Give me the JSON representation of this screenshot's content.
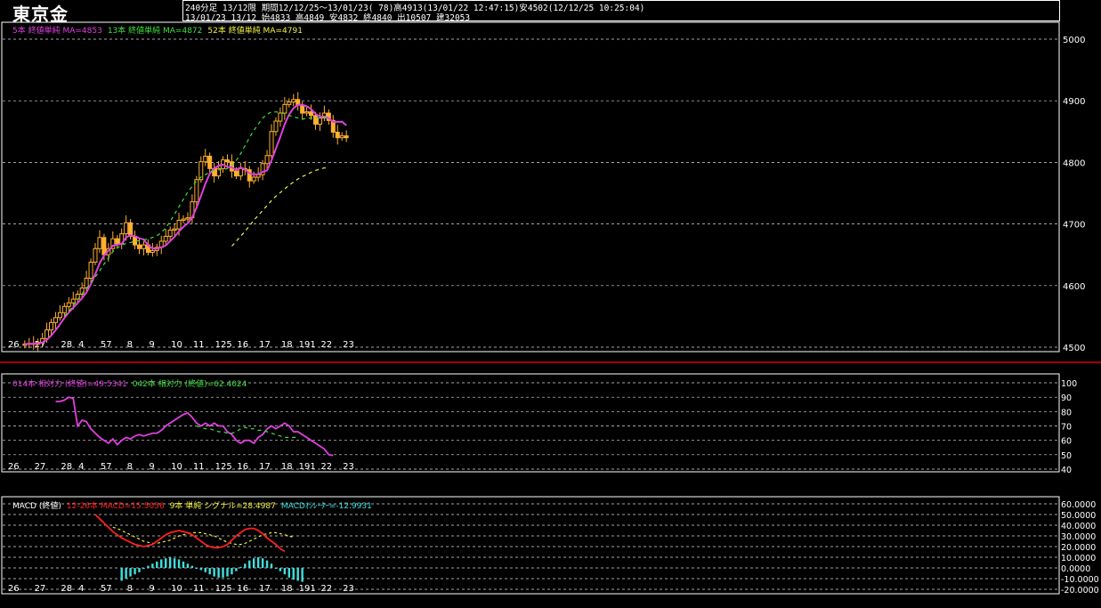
{
  "header": {
    "title": "東京金",
    "line1": "240分足 13/12限 期間12/12/25〜13/01/23( 78)高4913(13/01/22 12:47:15)安4502(12/12/25 10:25:04)",
    "line2": "13/01/23 13/12 始4833 高4849 安4832 終4840 出10507 建32053"
  },
  "colors": {
    "background": "#000000",
    "candle": "#ffb030",
    "ma5": "#e040e0",
    "ma13": "#40e040",
    "ma52": "#f0f040",
    "rsi14": "#e040e0",
    "rsi42": "#40e040",
    "macd": "#ff2020",
    "signal": "#f0f040",
    "oscillator": "#40e0e0",
    "separator": "#ff0000"
  },
  "legends": {
    "main": [
      {
        "text": "5本 終値単純 MA=4853",
        "color": "#e040e0"
      },
      {
        "text": "13本 終値単純 MA=4872",
        "color": "#40e040"
      },
      {
        "text": "52本 終値単純 MA=4791",
        "color": "#f0f040"
      }
    ],
    "rsi": [
      {
        "text": "014本 相対力 (終値)=49.5341",
        "color": "#e040e0"
      },
      {
        "text": "042本 相対力 (終値)=62.4024",
        "color": "#40e040"
      }
    ],
    "macd": [
      {
        "text": "MACD (終値)",
        "color": "#ffffff"
      },
      {
        "text": "12-26本 MACD=15.5056",
        "color": "#ff2020"
      },
      {
        "text": "9本 単純 シグナル=28.4987",
        "color": "#f0f040"
      },
      {
        "text": "MACDｵｼﾚｰﾀｰ=-12.9931",
        "color": "#40e0e0"
      }
    ]
  },
  "chart_data": [
    {
      "type": "candlestick",
      "name": "price",
      "ylim": [
        4500,
        5050
      ],
      "yticks": [
        "5000",
        "4900",
        "4800",
        "4700",
        "4600",
        "4500"
      ],
      "ytick_values": [
        5000,
        4900,
        4800,
        4700,
        4600,
        4500
      ],
      "date_labels": [
        "26",
        "27",
        "28",
        "4",
        "57",
        "8",
        "9",
        "10",
        "11",
        "125",
        "16",
        "17",
        "18",
        "191",
        "22",
        "23"
      ],
      "date_label_index": [
        1,
        7,
        13,
        17,
        22,
        28,
        33,
        38,
        43,
        48,
        53,
        58,
        63,
        67,
        72,
        77
      ],
      "close": [
        4505,
        4506,
        4505,
        4508,
        4514,
        4528,
        4540,
        4548,
        4556,
        4566,
        4572,
        4578,
        4586,
        4596,
        4612,
        4638,
        4660,
        4678,
        4650,
        4660,
        4676,
        4668,
        4684,
        4702,
        4680,
        4666,
        4660,
        4666,
        4654,
        4657,
        4662,
        4672,
        4680,
        4690,
        4692,
        4706,
        4708,
        4710,
        4736,
        4772,
        4801,
        4810,
        4790,
        4778,
        4790,
        4804,
        4801,
        4786,
        4778,
        4790,
        4788,
        4770,
        4776,
        4780,
        4798,
        4811,
        4850,
        4867,
        4880,
        4894,
        4898,
        4902,
        4893,
        4880,
        4882,
        4876,
        4862,
        4872,
        4880,
        4868,
        4849,
        4840,
        4843,
        4840
      ],
      "ma5": [
        4505,
        4505.5,
        4505.3,
        4506,
        4507.6,
        4512,
        4519,
        4527.6,
        4537.2,
        4547.6,
        4556.4,
        4564,
        4571.6,
        4579.6,
        4588.8,
        4602,
        4618.4,
        4636.4,
        4648.8,
        4656.8,
        4664.8,
        4666.4,
        4667.6,
        4678,
        4682,
        4680,
        4676.8,
        4674.8,
        4665.2,
        4660.6,
        4659.8,
        4662.2,
        4665,
        4672.2,
        4679.2,
        4688,
        4695.2,
        4701.2,
        4710.4,
        4726.4,
        4745.4,
        4765.4,
        4781.8,
        4790.2,
        4794.6,
        4796.4,
        4792.6,
        4791.8,
        4787.8,
        4791.8,
        4788.6,
        4782.4,
        4780.4,
        4780.8,
        4784.4,
        4787,
        4803,
        4822,
        4841.2,
        4862,
        4877.8,
        4888.2,
        4893.4,
        4893.4,
        4891,
        4886.6,
        4878.6,
        4874.4,
        4874.4,
        4871.6,
        4865.8,
        4865.8,
        4866,
        4860
      ],
      "ma13_start": 13,
      "ma13": [
        4551,
        4558,
        4567,
        4577,
        4587,
        4596,
        4603,
        4614,
        4624,
        4635,
        4645,
        4655,
        4661,
        4666,
        4668,
        4670,
        4672,
        4673,
        4674,
        4676,
        4678,
        4681,
        4686,
        4694,
        4704,
        4716,
        4728,
        4740,
        4752,
        4761,
        4770,
        4776,
        4780,
        4784,
        4787,
        4788,
        4788,
        4790,
        4795,
        4803,
        4814,
        4827,
        4840,
        4852,
        4862,
        4872,
        4878,
        4882,
        4882,
        4881,
        4879,
        4876,
        4874,
        4872,
        4870,
        4872,
        4872,
        4873,
        4872,
        4873,
        4872
      ],
      "ma52_start": 51,
      "ma52": [
        4664,
        4672,
        4680,
        4688,
        4697,
        4706,
        4714,
        4722,
        4730,
        4738,
        4745,
        4751,
        4757,
        4763,
        4768,
        4773,
        4777,
        4780,
        4784,
        4787,
        4789,
        4791,
        4791
      ]
    },
    {
      "type": "line",
      "name": "rsi",
      "ylim": [
        40,
        100
      ],
      "yticks": [
        "100",
        "90",
        "80",
        "70",
        "60",
        "50",
        "40"
      ],
      "ytick_values": [
        100,
        90,
        80,
        70,
        60,
        50,
        40
      ],
      "series": [
        {
          "name": "014本 相対力 (終値)",
          "start": 11,
          "values": [
            87,
            87,
            88,
            90,
            89,
            70,
            74,
            73,
            68,
            65,
            62,
            60,
            58,
            61,
            57,
            60,
            62,
            61,
            63,
            64,
            63,
            64,
            65,
            65,
            67,
            70,
            72,
            74,
            76,
            78,
            79,
            76,
            72,
            70,
            72,
            70,
            72,
            70,
            70,
            66,
            64,
            60,
            58,
            60,
            60,
            58,
            62,
            64,
            68,
            70,
            68,
            70,
            72,
            70,
            66,
            66,
            64,
            62,
            60,
            58,
            56,
            54,
            50,
            49.5
          ]
        },
        {
          "name": "042本 相対力 (終値)",
          "start": 43,
          "values": [
            70,
            69,
            68,
            68,
            67,
            66,
            66,
            65,
            65,
            66,
            68,
            69,
            68,
            68,
            67,
            67,
            66,
            65,
            64,
            63,
            62,
            62,
            62,
            62
          ]
        }
      ]
    },
    {
      "type": "line",
      "name": "macd",
      "ylim": [
        -20,
        60
      ],
      "yticks": [
        "60.0000",
        "50.0000",
        "40.0000",
        "30.0000",
        "20.0000",
        "10.0000",
        "0.0000",
        "-10.0000",
        "-20.0000"
      ],
      "ytick_values": [
        60,
        50,
        40,
        30,
        20,
        10,
        0,
        -10,
        -20
      ],
      "series": [
        {
          "name": "MACD",
          "start": 20,
          "values": [
            50,
            46,
            42,
            38,
            34,
            31,
            28,
            26,
            24,
            22,
            21,
            20,
            21,
            22,
            25,
            28,
            31,
            33,
            34,
            35,
            34,
            33,
            31,
            28,
            25,
            22,
            20,
            19,
            19,
            20,
            22,
            26,
            30,
            33,
            36,
            37,
            37,
            35,
            32,
            28,
            25,
            22,
            18,
            15.5
          ]
        },
        {
          "name": "シグナル",
          "start": 24,
          "values": [
            38,
            37,
            35,
            33,
            31,
            29,
            27,
            25,
            24,
            23,
            23,
            24,
            25,
            26,
            28,
            30,
            31,
            32,
            33,
            33,
            33,
            32,
            31,
            30,
            28,
            26,
            24,
            23,
            22,
            22,
            23,
            25,
            27,
            29,
            31,
            32,
            33,
            33,
            32,
            31,
            30,
            28.5
          ]
        },
        {
          "name": "MACDｵｼﾚｰﾀｰ",
          "start": 26,
          "values": [
            -12,
            -10,
            -8,
            -6,
            -4,
            -1,
            2,
            4,
            6,
            8,
            9,
            10,
            9,
            8,
            6,
            4,
            2,
            0,
            -2,
            -4,
            -6,
            -8,
            -9,
            -9,
            -8,
            -6,
            -3,
            1,
            4,
            7,
            9,
            10,
            9,
            7,
            4,
            0,
            -3,
            -6,
            -9,
            -11,
            -12,
            -13
          ]
        }
      ]
    }
  ]
}
